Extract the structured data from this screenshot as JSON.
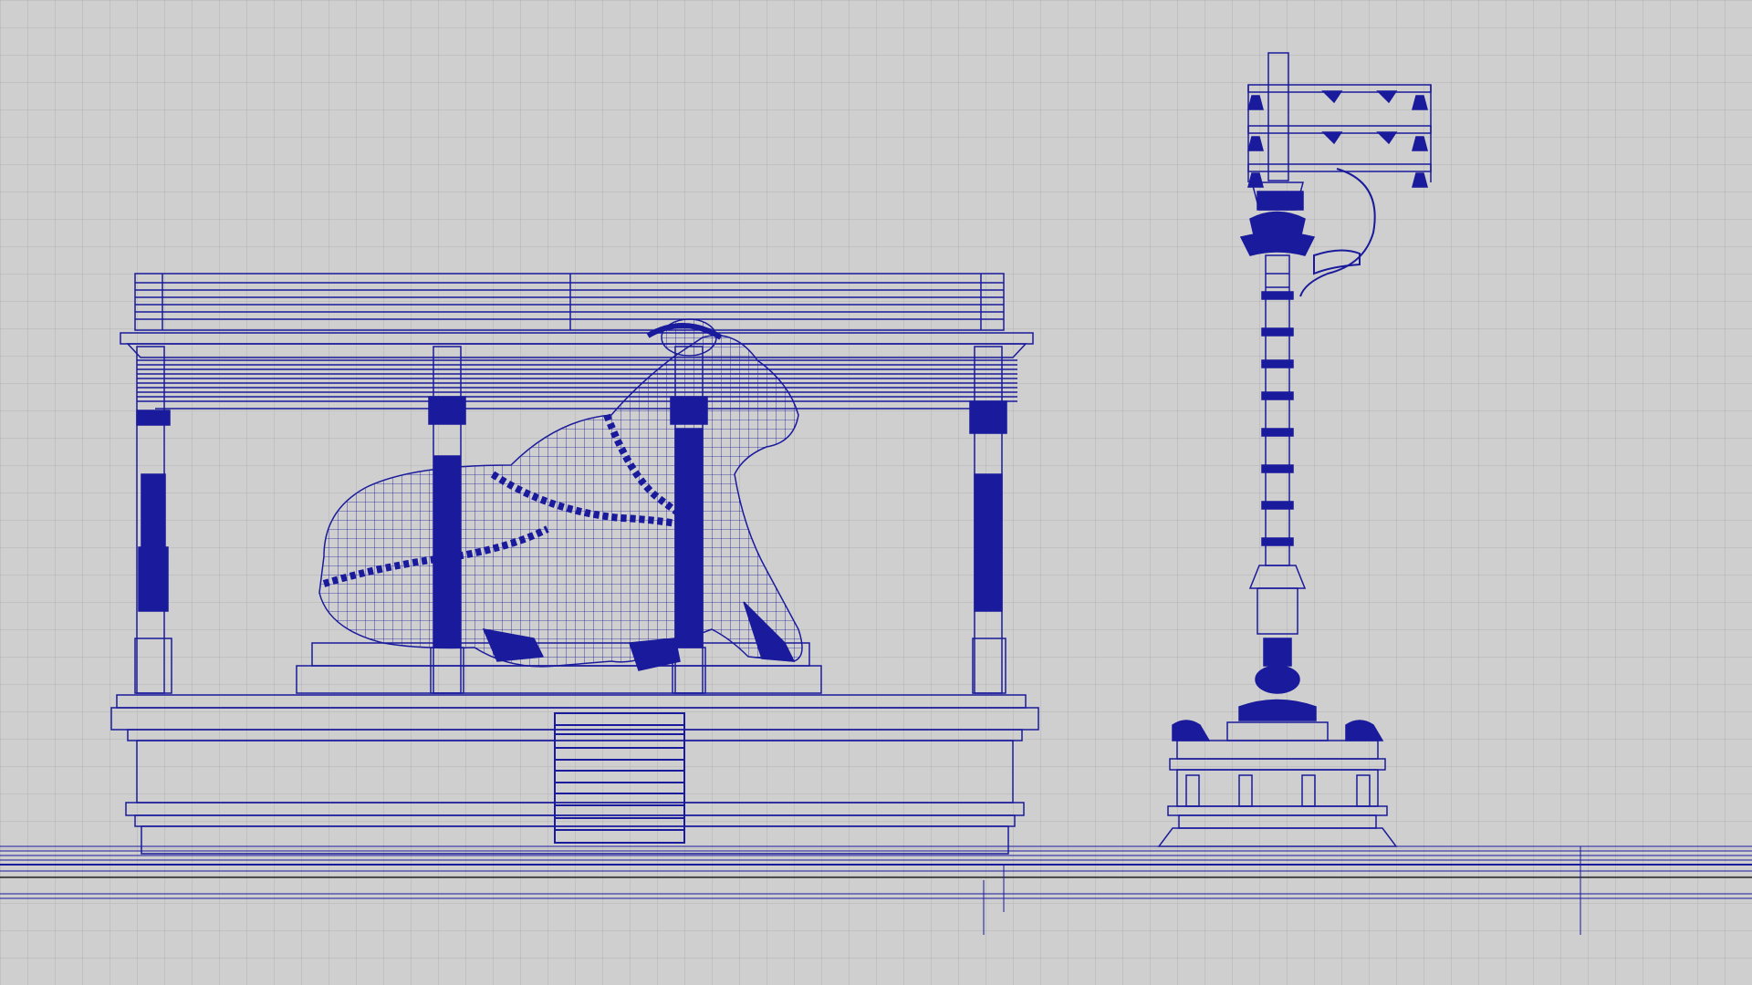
{
  "viewport": {
    "name": "front-orthographic-viewport",
    "background": "#cfcfcf",
    "grid_color": "#b3b3b3",
    "wire_color": "#1a1a9c",
    "display_mode": "wireframe"
  },
  "objects": [
    {
      "name": "nandi-mandapam",
      "parts": [
        "roof-slab",
        "cornice",
        "pillar",
        "plinth",
        "steps"
      ],
      "pillar_count": 4
    },
    {
      "name": "nandi-statue",
      "pose": "seated bull"
    },
    {
      "name": "dhwaja-stambham",
      "parts": [
        "bell-frame",
        "bells",
        "shaft",
        "capital",
        "base-platform"
      ]
    }
  ]
}
